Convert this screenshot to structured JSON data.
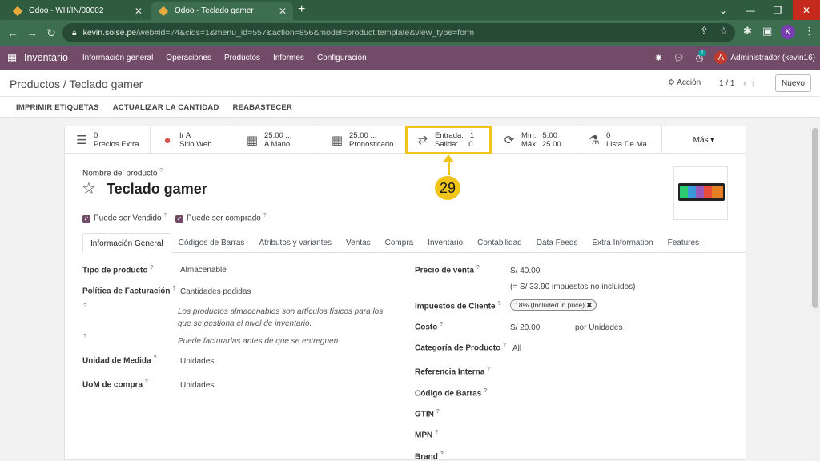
{
  "browser": {
    "tabs": [
      {
        "title": "Odoo - WH/IN/00002",
        "close": "✕"
      },
      {
        "title": "Odoo - Teclado gamer",
        "close": "✕"
      }
    ],
    "new_tab": "+",
    "url_host": "kevin.solse.pe",
    "url_path": "/web#id=74&cids=1&menu_id=557&action=856&model=product.template&view_type=form",
    "profile_initial": "K"
  },
  "odoo_nav": {
    "app_name": "Inventario",
    "menu": [
      "Información general",
      "Operaciones",
      "Productos",
      "Informes",
      "Configuración"
    ],
    "activity_count": "1",
    "user_initial": "A",
    "user_name": "Administrador (kevin16)"
  },
  "control_panel": {
    "breadcrumb": "Productos / Teclado gamer",
    "action_label": "Acción",
    "pager": "1 / 1",
    "new_button": "Nuevo",
    "actions": [
      "IMPRIMIR ETIQUETAS",
      "ACTUALIZAR LA CANTIDAD",
      "REABASTECER"
    ]
  },
  "stat_buttons": [
    {
      "icon": "list-icon",
      "glyph": "☰",
      "line1": "0",
      "line2": "Precios Extra"
    },
    {
      "icon": "globe-icon",
      "glyph": "●",
      "line1": "Ir A",
      "line2": "Sitio Web"
    },
    {
      "icon": "cubes-icon",
      "glyph": "▦",
      "line1": "25.00 ...",
      "line2": "A Mano"
    },
    {
      "icon": "cubes-forecast-icon",
      "glyph": "▦",
      "line1": "25.00 ...",
      "line2": "Pronosticado"
    },
    {
      "icon": "exchange-icon",
      "glyph": "⇄",
      "line1": "Entrada:   1",
      "line2": "Salida:     0"
    },
    {
      "icon": "refresh-icon",
      "glyph": "⟳",
      "line1": "Mín:   5.00",
      "line2": "Máx:  25.00"
    },
    {
      "icon": "flask-icon",
      "glyph": "⚗",
      "line1": "0",
      "line2": "Lista De Ma..."
    }
  ],
  "more_button": "Más ▾",
  "callout_number": "29",
  "product": {
    "name_label": "Nombre del producto",
    "name": "Teclado gamer",
    "can_be_sold": "Puede ser Vendido",
    "can_be_purchased": "Puede ser comprado"
  },
  "form_tabs": [
    "Información General",
    "Códigos de Barras",
    "Atributos y variantes",
    "Ventas",
    "Compra",
    "Inventario",
    "Contabilidad",
    "Data Feeds",
    "Extra Information",
    "Features"
  ],
  "left_fields": {
    "product_type_label": "Tipo de producto",
    "product_type": "Almacenable",
    "invoice_policy_label": "Política de Facturación",
    "invoice_policy": "Cantidades pedidas",
    "help_storable": "Los productos almacenables son artículos físicos para los que se gestiona el nivel de inventario.",
    "help_invoice": "Puede facturarlas antes de que se entreguen.",
    "uom_label": "Unidad de Medida",
    "uom": "Unidades",
    "purchase_uom_label": "UoM de compra",
    "purchase_uom": "Unidades"
  },
  "right_fields": {
    "sale_price_label": "Precio de venta",
    "sale_price": "S/ 40.00",
    "tax_note": "(= S/ 33.90 impuestos no incluidos)",
    "customer_taxes_label": "Impuestos de Cliente",
    "customer_tax_tag": "18% (Included in price) ✖",
    "cost_label": "Costo",
    "cost": "S/ 20.00",
    "cost_unit": "por Unidades",
    "category_label": "Categoría de Producto",
    "category": "All",
    "internal_ref_label": "Referencia Interna",
    "barcode_label": "Código de Barras",
    "gtin_label": "GTIN",
    "mpn_label": "MPN",
    "brand_label": "Brand"
  },
  "colors": {
    "odoo_purple": "#714b67",
    "chrome_green": "#2f5c3f",
    "callout_yellow": "#f0c419"
  }
}
